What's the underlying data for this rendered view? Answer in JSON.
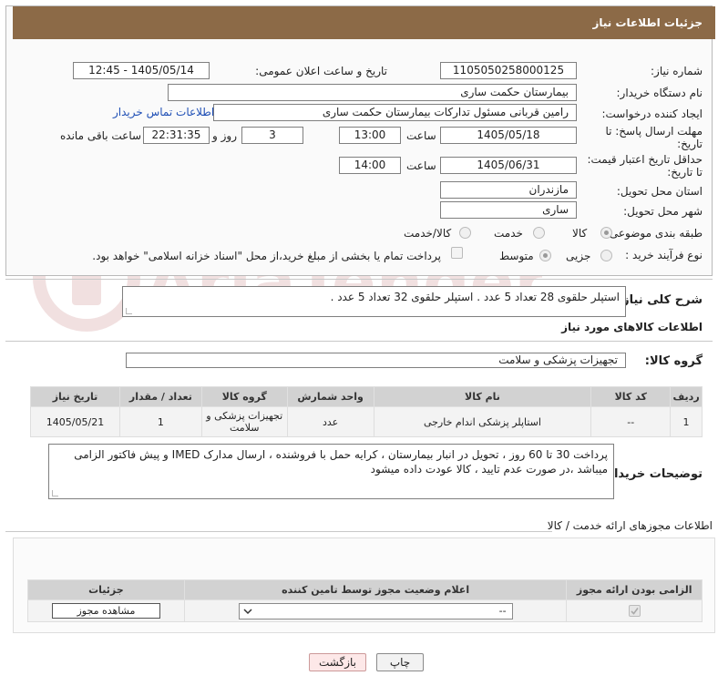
{
  "header": {
    "title": "جزئیات اطلاعات نیاز"
  },
  "form": {
    "need_number_label": "شماره نیاز:",
    "need_number": "1105050258000125",
    "announce_label": "تاریخ و ساعت اعلان عمومی:",
    "announce_value": "1405/05/14 - 12:45",
    "buyer_org_label": "نام دستگاه خریدار:",
    "buyer_org": "بیمارستان حکمت ساری",
    "creator_label": "ایجاد کننده درخواست:",
    "creator": "رامین  قربانی مسئول تدارکات بیمارستان حکمت ساری",
    "contact_link": "اطلاعات تماس خریدار",
    "deadline_label_1": "مهلت ارسال پاسخ: تا",
    "deadline_label_2": "تاریخ:",
    "deadline_date": "1405/05/18",
    "time_label": "ساعت",
    "deadline_time": "13:00",
    "days_value": "3",
    "days_label": "روز و",
    "remaining_time": "22:31:35",
    "remaining_label": "ساعت باقی مانده",
    "validity_label_1": "حداقل تاریخ اعتبار قیمت:",
    "validity_label_2": "تا تاریخ:",
    "validity_date": "1405/06/31",
    "validity_time_label": "ساعت",
    "validity_time": "14:00",
    "province_label": "استان محل تحویل:",
    "province": "مازندران",
    "city_label": "شهر محل تحویل:",
    "city": "ساری",
    "category_label": "طبقه بندی موضوعی:",
    "category_options": [
      "کالا",
      "خدمت",
      "کالا/خدمت"
    ],
    "purchase_type_label": "نوع فرآیند خرید :",
    "purchase_options": [
      "جزیی",
      "متوسط"
    ],
    "treasury_text": "پرداخت تمام یا بخشی از مبلغ خرید،از محل \"اسناد خزانه اسلامی\" خواهد بود."
  },
  "description": {
    "label": "شرح کلی نیاز:",
    "text": "استپلر حلقوی 28 تعداد 5 عدد . استپلر حلقوی 32 تعداد 5 عدد ."
  },
  "goods": {
    "section_title": "اطلاعات کالاهای مورد نیاز",
    "group_label": "گروه کالا:",
    "group_value": "تجهیزات پزشکی و سلامت",
    "columns": [
      "ردیف",
      "کد کالا",
      "نام کالا",
      "واحد شمارش",
      "گروه کالا",
      "تعداد / مقدار",
      "تاریخ نیاز"
    ],
    "rows": [
      [
        "1",
        "--",
        "استاپلر پزشکی اندام خارجی",
        "عدد",
        "تجهیزات پزشکی و سلامت",
        "1",
        "1405/05/21"
      ]
    ]
  },
  "buyer_notes": {
    "label": "توضیحات خریدار:",
    "text": "پرداخت 30 تا 60  روز  ، تحویل در انبار بیمارستان ، کرایه حمل با فروشنده ، ارسال مدارک IMED  و پیش فاکتور الزامی میباشد ،در صورت عدم تایید ، کالا عودت داده میشود"
  },
  "permits": {
    "section_title": "اطلاعات مجوزهای ارائه خدمت / کالا",
    "columns": [
      "الزامی بودن ارائه مجوز",
      "اعلام وضعیت مجوز توسط تامین کننده",
      "جزئیات"
    ],
    "select_value": "--",
    "view_button": "مشاهده مجوز"
  },
  "footer": {
    "print_button": "چاپ",
    "back_button": "بازگشت"
  },
  "watermark": {
    "text": "AriaTender.neT"
  },
  "colors": {
    "title_bar": "#8c6a47",
    "link": "#1f4fb5",
    "table_header": "#d2d2d2"
  }
}
